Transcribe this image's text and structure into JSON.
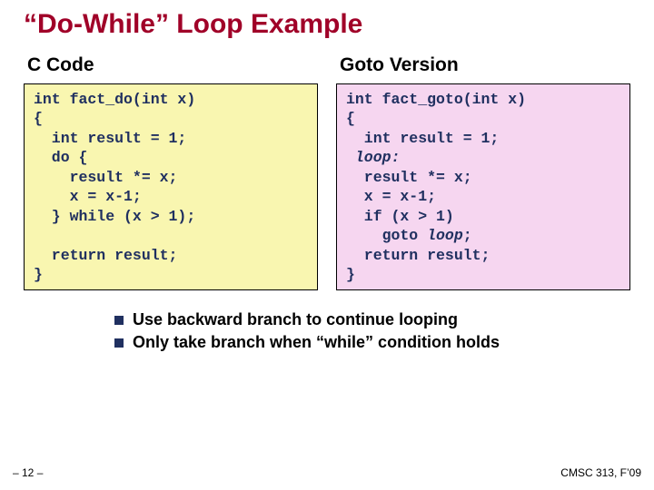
{
  "title": "“Do-While” Loop Example",
  "left": {
    "heading": "C Code",
    "code": "int fact_do(int x)\n{\n  int result = 1;\n  do {\n    result *= x;\n    x = x-1;\n  } while (x > 1);\n\n  return result;\n}"
  },
  "right": {
    "heading": "Goto Version",
    "code_pre": "int fact_goto(int x)\n{\n  int result = 1;\n ",
    "code_loop_label": "loop:",
    "code_mid": "\n  result *= x;\n  x = x-1;\n  if (x > 1)\n    goto ",
    "code_loop_kw": "loop",
    "code_post": ";\n  return result;\n}"
  },
  "bullets": [
    "Use backward branch to continue looping",
    "Only take branch when “while” condition holds"
  ],
  "footer": {
    "left": "– 12 –",
    "right": "CMSC 313, F’09"
  }
}
